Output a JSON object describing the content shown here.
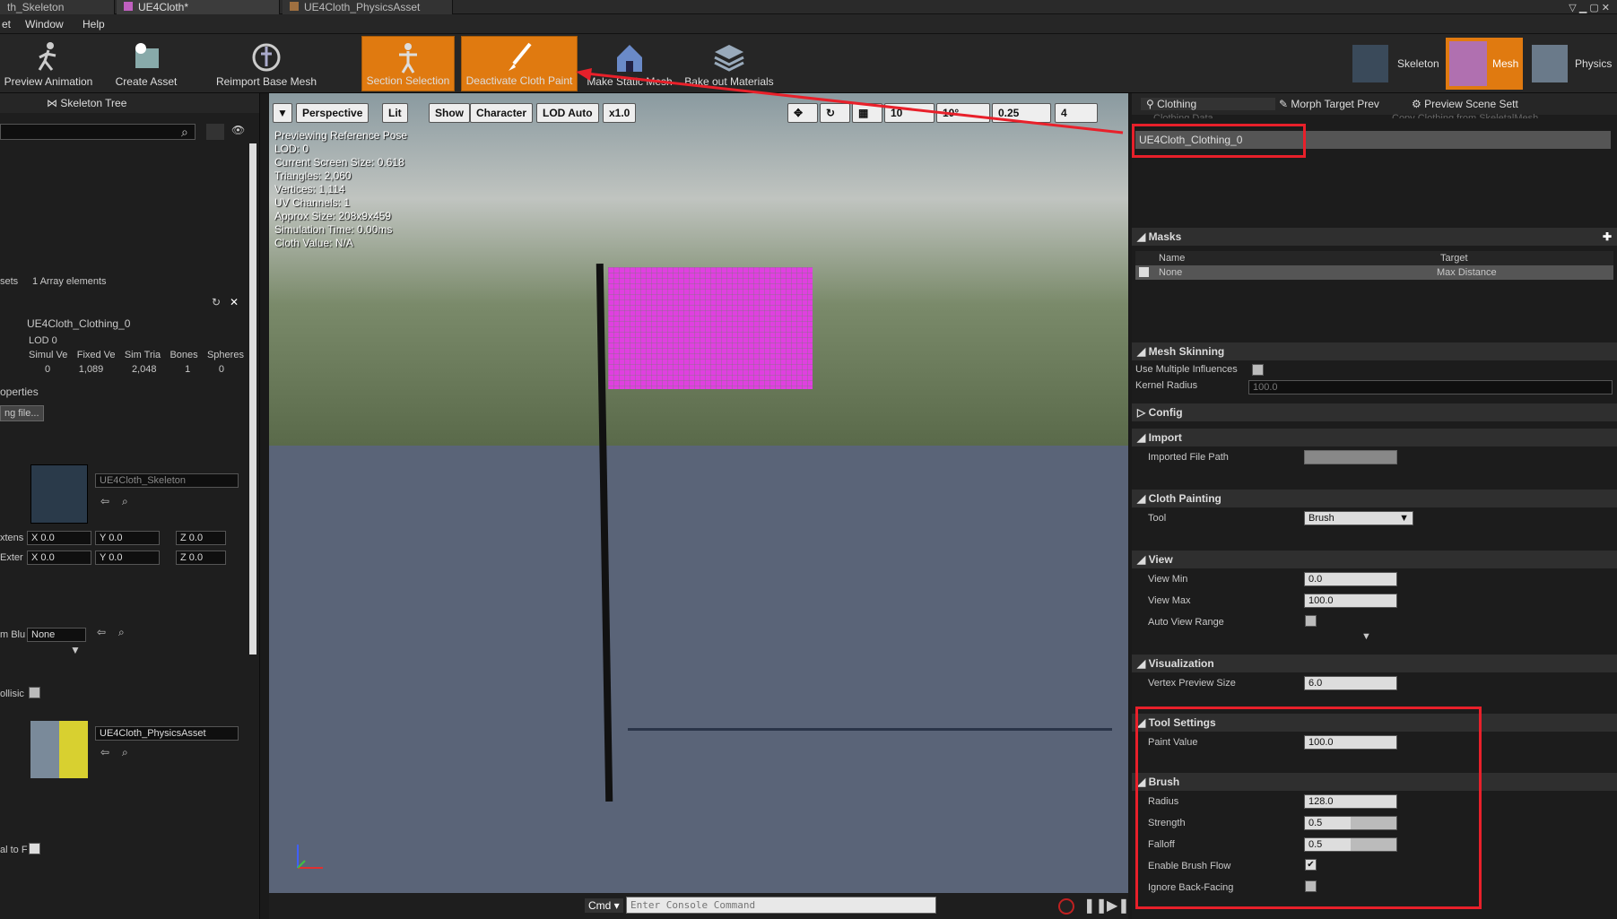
{
  "tabs": [
    "th_Skeleton",
    "UE4Cloth*",
    "UE4Cloth_PhysicsAsset"
  ],
  "menu": {
    "item0": "et",
    "window": "Window",
    "help": "Help"
  },
  "toolbar": {
    "preview_animation": "Preview Animation",
    "create_asset": "Create Asset",
    "reimport_base_mesh": "Reimport Base Mesh",
    "section_selection": "Section Selection",
    "deactivate_cloth_paint": "Deactivate Cloth Paint",
    "make_static_mesh": "Make Static Mesh",
    "bake_out_materials": "Bake out Materials",
    "skeleton": "Skeleton",
    "mesh": "Mesh",
    "physics": "Physics"
  },
  "left": {
    "tab_skeleton_tree": "Skeleton Tree",
    "array_prefix": "sets",
    "array_elements": "1 Array elements",
    "clothing_name": "UE4Cloth_Clothing_0",
    "lod": "LOD 0",
    "table_headers": [
      "Simul Ve",
      "Fixed Ve",
      "Sim Tria",
      "Bones",
      "Spheres"
    ],
    "table_values": [
      "0",
      "1,089",
      "2,048",
      "1",
      "0"
    ],
    "properties": "operties",
    "file_button": "ng file...",
    "skeleton_asset": "UE4Cloth_Skeleton",
    "ext1_label": "xtens",
    "ext2_label": "Exter",
    "x_val": "X 0.0",
    "y_val": "Y 0.0",
    "z_val": "Z 0.0",
    "blu_label": "m Blu",
    "none_select": "None",
    "collision_label": "ollisic",
    "physics_asset": "UE4Cloth_PhysicsAsset",
    "bottom_label": "al to F"
  },
  "viewport": {
    "perspective": "Perspective",
    "lit": "Lit",
    "show": "Show",
    "character": "Character",
    "lod_auto": "LOD Auto",
    "speed": "x1.0",
    "grid": "10",
    "angle": "10°",
    "scale": "0.25",
    "cam_speed": "4",
    "stats": [
      "Previewing Reference Pose",
      "LOD: 0",
      "Current Screen Size: 0.618",
      "Triangles: 2,060",
      "Vertices: 1,114",
      "UV Channels: 1",
      "Approx Size: 208x9x459",
      "Simulation Time: 0.00ms",
      "Cloth Value: N/A"
    ],
    "cmd": "Cmd",
    "console_placeholder": "Enter Console Command"
  },
  "right": {
    "tabs": [
      "Clothing",
      "Morph Target Prev",
      "Preview Scene Sett"
    ],
    "header_cut": "Clothing Data",
    "copy_label": "Copy Clothing from SkeletalMesh",
    "clothing_item": "UE4Cloth_Clothing_0",
    "masks": "Masks",
    "col_name": "Name",
    "col_target": "Target",
    "mask_name": "None",
    "mask_target": "Max Distance",
    "mesh_skinning": "Mesh Skinning",
    "use_multiple": "Use Multiple Influences",
    "kernel_radius": "Kernel Radius",
    "kernel_value": "100.0",
    "config": "Config",
    "import": "Import",
    "imported_path": "Imported File Path",
    "cloth_painting": "Cloth Painting",
    "tool": "Tool",
    "tool_value": "Brush",
    "view": "View",
    "view_min": "View Min",
    "view_min_val": "0.0",
    "view_max": "View Max",
    "view_max_val": "100.0",
    "auto_range": "Auto View Range",
    "visualization": "Visualization",
    "vertex_size": "Vertex Preview Size",
    "vertex_size_val": "6.0",
    "tool_settings": "Tool Settings",
    "paint_value": "Paint Value",
    "paint_value_val": "100.0",
    "brush": "Brush",
    "radius": "Radius",
    "radius_val": "128.0",
    "strength": "Strength",
    "strength_val": "0.5",
    "falloff": "Falloff",
    "falloff_val": "0.5",
    "enable_flow": "Enable Brush Flow",
    "ignore_back": "Ignore Back-Facing"
  },
  "colors": {
    "accent": "#e07a10",
    "highlight": "#e8202a",
    "cloth": "#e040e0"
  }
}
